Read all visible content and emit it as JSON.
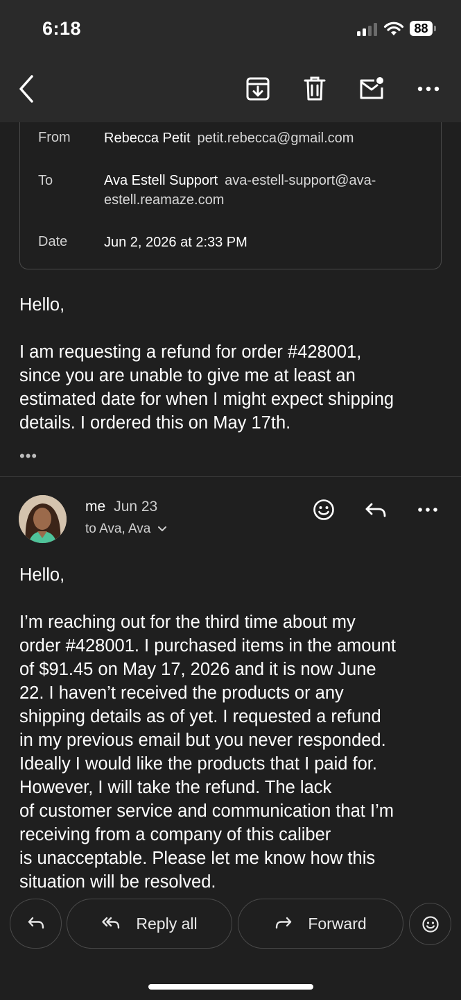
{
  "status_bar": {
    "time": "6:18",
    "battery": "88"
  },
  "toolbar": {
    "back_icon": "chevron-left-icon",
    "archive_icon": "archive-icon",
    "delete_icon": "trash-icon",
    "unread_icon": "mail-unread-icon",
    "more_icon": "more-horizontal-icon"
  },
  "first_message": {
    "details": {
      "from_label": "From",
      "from_name": "Rebecca Petit",
      "from_email": "petit.rebecca@gmail.com",
      "to_label": "To",
      "to_name": "Ava Estell Support",
      "to_email_line1": "ava-estell-support@ava-",
      "to_email_line2": "estell.reamaze.com",
      "date_label": "Date",
      "date_value": "Jun 2, 2026 at 2:33 PM"
    },
    "greeting": "Hello,",
    "body_lines": [
      "I am requesting a refund for order #428001,",
      "since you are unable to give me at least an",
      "estimated date for when I might expect shipping",
      "details. I ordered this on May 17th."
    ],
    "expand": "•••"
  },
  "second_message": {
    "sender": "me",
    "date": "Jun 23",
    "recipients": "to Ava, Ava",
    "greeting": "Hello,",
    "body_lines": [
      "I’m reaching out for the third time about my",
      "order #428001. I purchased items in the amount",
      "of $91.45 on May 17, 2026 and it is now June",
      "22. I haven’t received the products or any",
      "shipping details as of yet. I requested a refund",
      "in my previous email but you never responded.",
      "Ideally I would like the products that I paid for.",
      "However, I will take the refund. The lack",
      "of customer service and communication that I’m",
      "receiving from a company of this caliber",
      "is unacceptable. Please let me know how this",
      "situation will be resolved."
    ]
  },
  "actions": {
    "reply_all": "Reply all",
    "forward": "Forward"
  },
  "colors": {
    "background": "#1f1f1f",
    "header": "#2a2a2a",
    "border": "#4a4a4a",
    "text": "#ffffff",
    "muted_text": "#d0d0d0"
  }
}
